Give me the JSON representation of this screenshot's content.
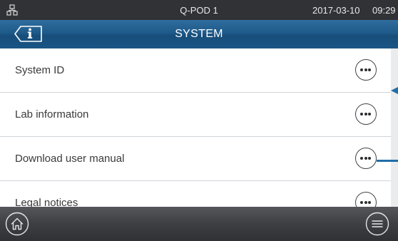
{
  "status_bar": {
    "device_name": "Q-POD 1",
    "date": "2017-03-10",
    "time": "09:29",
    "network_icon": "network-icon"
  },
  "header": {
    "title": "SYSTEM",
    "info_icon": "info-icon"
  },
  "list": {
    "items": [
      {
        "label": "System ID"
      },
      {
        "label": "Lab information"
      },
      {
        "label": "Download user manual"
      },
      {
        "label": "Legal notices"
      }
    ],
    "more_icon": "more-options-icon"
  },
  "footer": {
    "home_icon": "home-icon",
    "menu_icon": "menu-icon"
  },
  "colors": {
    "status_bar": "#303236",
    "title_bar": "#1e5a8a",
    "accent": "#1f6ea8",
    "footer": "#3d3f43"
  }
}
